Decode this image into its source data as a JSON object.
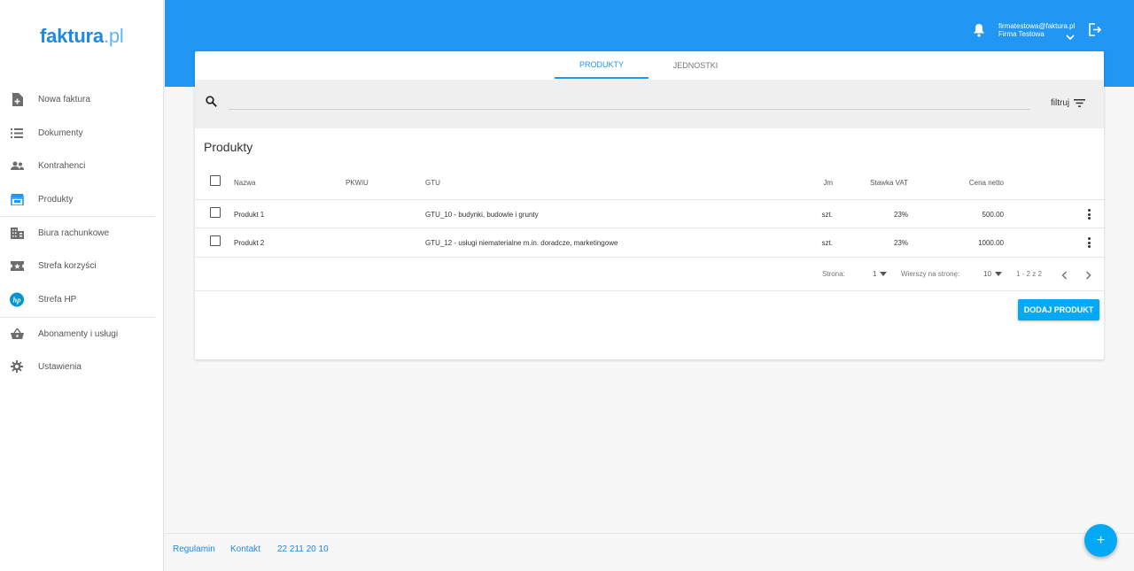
{
  "logo": {
    "name": "faktura",
    "ext": ".pl"
  },
  "sidebar": {
    "items": [
      {
        "label": "Nowa faktura",
        "icon": "document-add-icon"
      },
      {
        "label": "Dokumenty",
        "icon": "list-icon"
      },
      {
        "label": "Kontrahenci",
        "icon": "people-icon"
      },
      {
        "label": "Produkty",
        "icon": "store-icon"
      },
      {
        "label": "Biura rachunkowe",
        "icon": "building-icon"
      },
      {
        "label": "Strefa korzyści",
        "icon": "ticket-icon"
      },
      {
        "label": "Strefa HP",
        "icon": "hp-logo-icon"
      },
      {
        "label": "Abonamenty i usługi",
        "icon": "basket-icon"
      },
      {
        "label": "Ustawienia",
        "icon": "gear-icon"
      }
    ]
  },
  "header": {
    "user_email": "firmatestowa@faktura.pl",
    "company": "Firma Testowa"
  },
  "tabs": [
    {
      "label": "PRODUKTY",
      "active": true
    },
    {
      "label": "JEDNOSTKI",
      "active": false
    }
  ],
  "search": {
    "placeholder": ""
  },
  "filter_label": "filtruj",
  "section_title": "Produkty",
  "table": {
    "columns": {
      "name": "Nazwa",
      "pkwiu": "PKWiU",
      "gtu": "GTU",
      "jm": "Jm",
      "vat": "Stawka VAT",
      "net": "Cena netto"
    },
    "rows": [
      {
        "name": "Produkt 1",
        "pkwiu": "",
        "gtu": "GTU_10 - budynki, budowle i grunty",
        "jm": "szt.",
        "vat": "23%",
        "net": "500.00"
      },
      {
        "name": "Produkt 2",
        "pkwiu": "",
        "gtu": "GTU_12 - usługi niematerialne m.in. doradcze, marketingowe",
        "jm": "szt.",
        "vat": "23%",
        "net": "1000.00"
      }
    ]
  },
  "pagination": {
    "page_label": "Strona:",
    "page_value": "1",
    "rows_label": "Wierszy na stronę:",
    "rows_value": "10",
    "range": "1 - 2 z 2"
  },
  "add_button": "DODAJ PRODUKT",
  "footer": {
    "links": [
      "Regulamin",
      "Kontakt",
      "22 211 20 10"
    ]
  },
  "fab_label": "+",
  "colors": {
    "primary": "#2196f3",
    "accent": "#03a9f4"
  }
}
